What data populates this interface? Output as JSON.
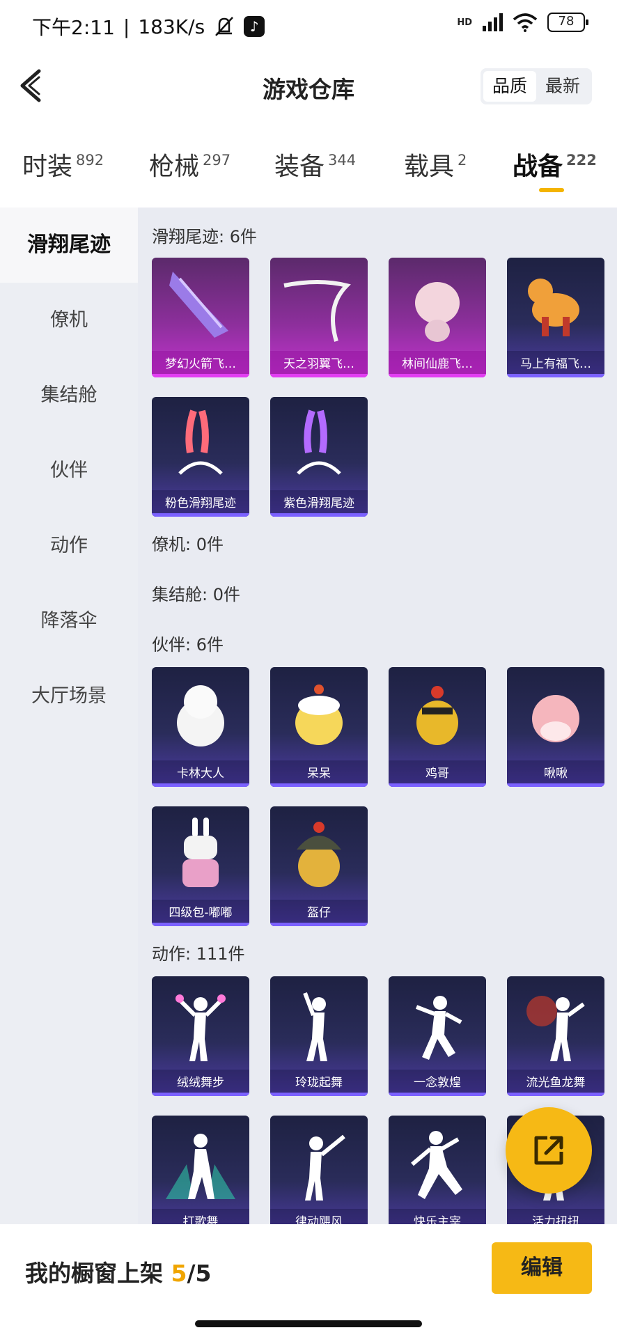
{
  "status_bar": {
    "time": "下午2:11",
    "speed": "183K/s",
    "network": "HD",
    "battery": "78"
  },
  "header": {
    "title": "游戏仓库",
    "sort_quality": "品质",
    "sort_latest": "最新"
  },
  "categories": [
    {
      "label": "时装",
      "count": "892"
    },
    {
      "label": "枪械",
      "count": "297"
    },
    {
      "label": "装备",
      "count": "344"
    },
    {
      "label": "载具",
      "count": "2"
    },
    {
      "label": "战备",
      "count": "222"
    }
  ],
  "sidebar": [
    "滑翔尾迹",
    "僚机",
    "集结舱",
    "伙伴",
    "动作",
    "降落伞",
    "大厅场景"
  ],
  "sections": {
    "glide": {
      "title": "滑翔尾迹: 6件",
      "items": [
        "梦幻火箭飞…",
        "天之羽翼飞…",
        "林间仙鹿飞…",
        "马上有福飞…",
        "粉色滑翔尾迹",
        "紫色滑翔尾迹"
      ]
    },
    "wingman": {
      "title": "僚机: 0件"
    },
    "capsule": {
      "title": "集结舱: 0件"
    },
    "partner": {
      "title": "伙伴: 6件",
      "items": [
        "卡林大人",
        "呆呆",
        "鸡哥",
        "啾啾",
        "四级包-嘟嘟",
        "盔仔"
      ]
    },
    "emote": {
      "title": "动作: 111件",
      "items": [
        "绒绒舞步",
        "玲珑起舞",
        "一念敦煌",
        "流光鱼龙舞",
        "打歌舞",
        "律动飓风",
        "快乐主宰",
        "活力扭扭"
      ]
    }
  },
  "bottom": {
    "shelf_label": "我的橱窗上架",
    "shelf_current": "5",
    "shelf_total": "/5",
    "edit_label": "编辑"
  }
}
